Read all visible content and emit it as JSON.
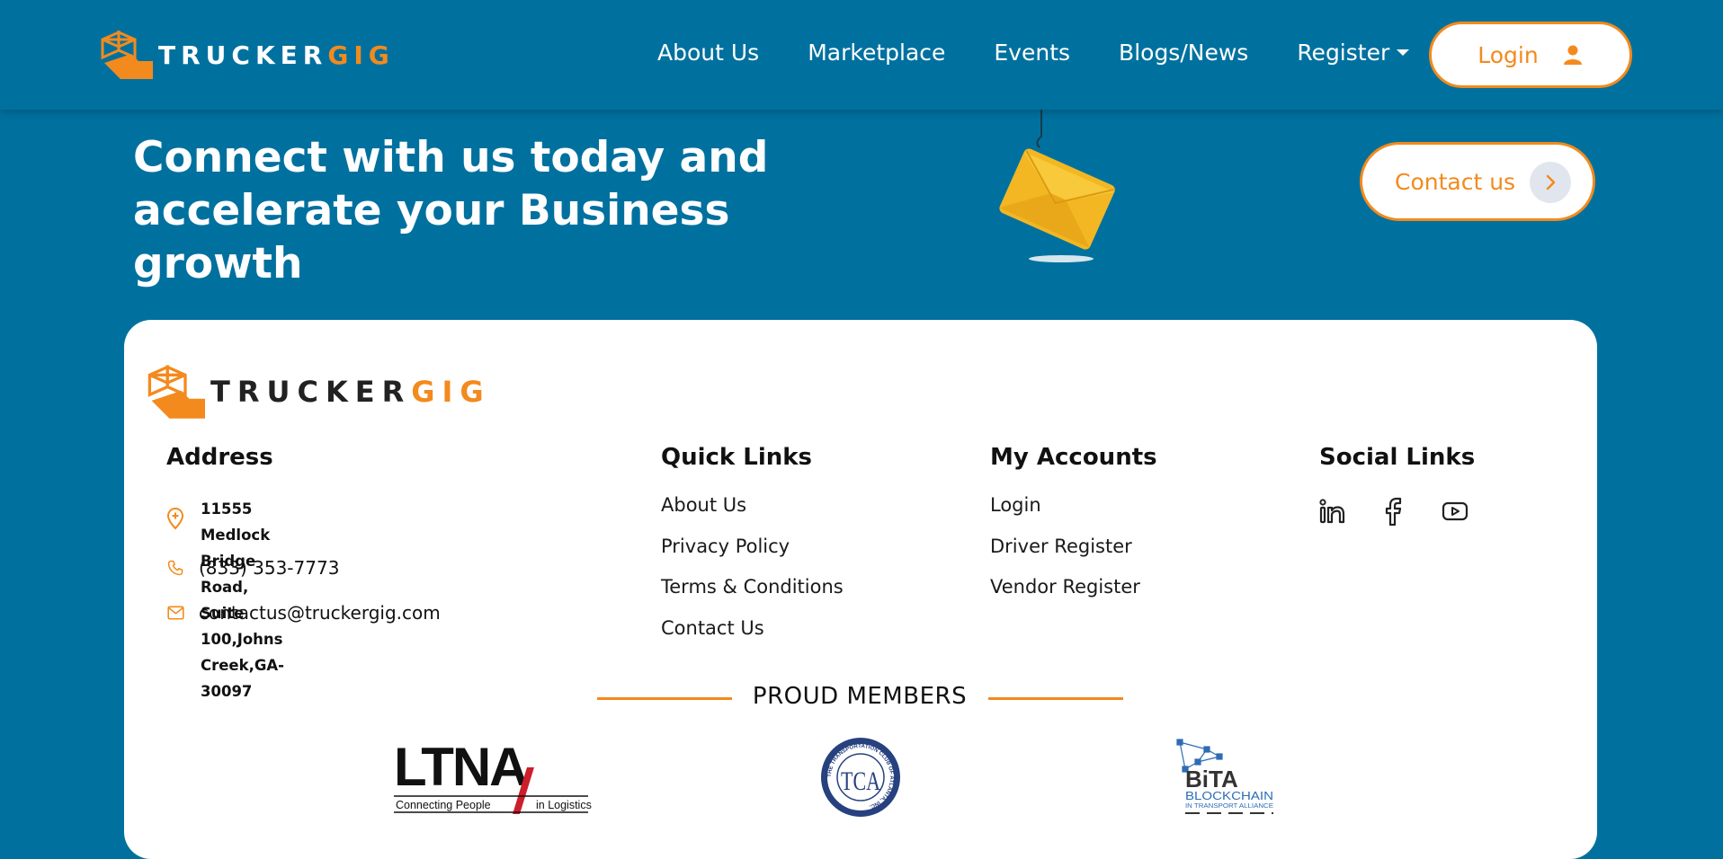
{
  "brand": {
    "name_part1": "TRUCKER",
    "name_part2": "GIG"
  },
  "colors": {
    "primary_blue": "#00719f",
    "accent_orange": "#f38a1d",
    "white": "#ffffff"
  },
  "nav": {
    "items": [
      "About Us",
      "Marketplace",
      "Events",
      "Blogs/News"
    ],
    "register_label": "Register",
    "login_label": "Login"
  },
  "hero": {
    "title_line1": "Connect with us today and",
    "title_line2": "accelerate your Business growth",
    "contact_label": "Contact us"
  },
  "footer": {
    "address": {
      "title": "Address",
      "line1": "11555 Medlock Bridge Road,",
      "line2": "Suite 100,Johns Creek,GA-30097",
      "phone": "(833) 353-7773",
      "email": "contactus@truckergig.com"
    },
    "quick_links": {
      "title": "Quick Links",
      "items": [
        "About Us",
        "Privacy Policy",
        "Terms & Conditions",
        "Contact Us"
      ]
    },
    "my_accounts": {
      "title": "My Accounts",
      "items": [
        "Login",
        "Driver Register",
        "Vendor Register"
      ]
    },
    "social_links": {
      "title": "Social Links",
      "icons": [
        "linkedin-icon",
        "facebook-icon",
        "youtube-icon"
      ]
    },
    "members": {
      "title": "PROUD MEMBERS",
      "ltna": {
        "word": "LTNA",
        "tag_left": "Connecting People",
        "tag_right": "in Logistics"
      },
      "tca": {
        "letters": "TCA",
        "ring_text": "THE TRANSPORTATION CLUB OF ATLANTA, INC."
      },
      "bita": {
        "word": "BiTA",
        "sub": "BLOCKCHAIN",
        "tag": "IN TRANSPORT ALLIANCE"
      }
    }
  }
}
